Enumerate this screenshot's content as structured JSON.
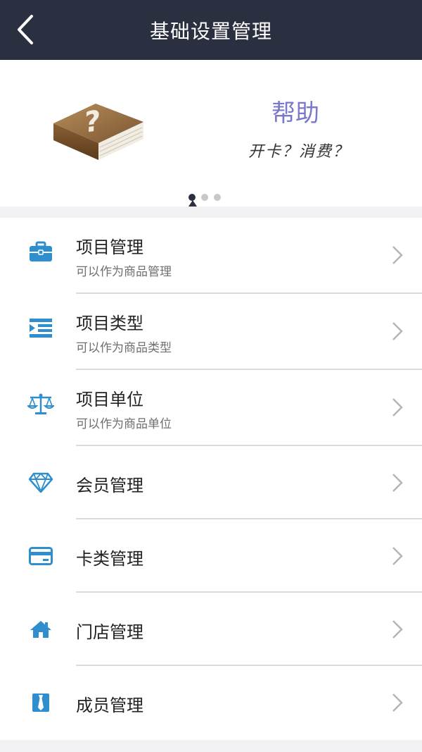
{
  "header": {
    "title": "基础设置管理"
  },
  "banner": {
    "title": "帮助",
    "subtitle": "开卡？消费？",
    "pagination": {
      "current": 1,
      "total": 3
    }
  },
  "menu": {
    "items": [
      {
        "title": "项目管理",
        "subtitle": "可以作为商品管理",
        "icon": "briefcase-icon"
      },
      {
        "title": "项目类型",
        "subtitle": "可以作为商品类型",
        "icon": "list-indent-icon"
      },
      {
        "title": "项目单位",
        "subtitle": "可以作为商品单位",
        "icon": "scale-icon"
      },
      {
        "title": "会员管理",
        "icon": "diamond-icon"
      },
      {
        "title": "卡类管理",
        "icon": "card-icon"
      },
      {
        "title": "门店管理",
        "icon": "home-icon"
      },
      {
        "title": "成员管理",
        "icon": "tie-icon"
      }
    ]
  },
  "colors": {
    "header_bg": "#2b3040",
    "icon_blue": "#2f8fce",
    "banner_title": "#7a78cc"
  }
}
